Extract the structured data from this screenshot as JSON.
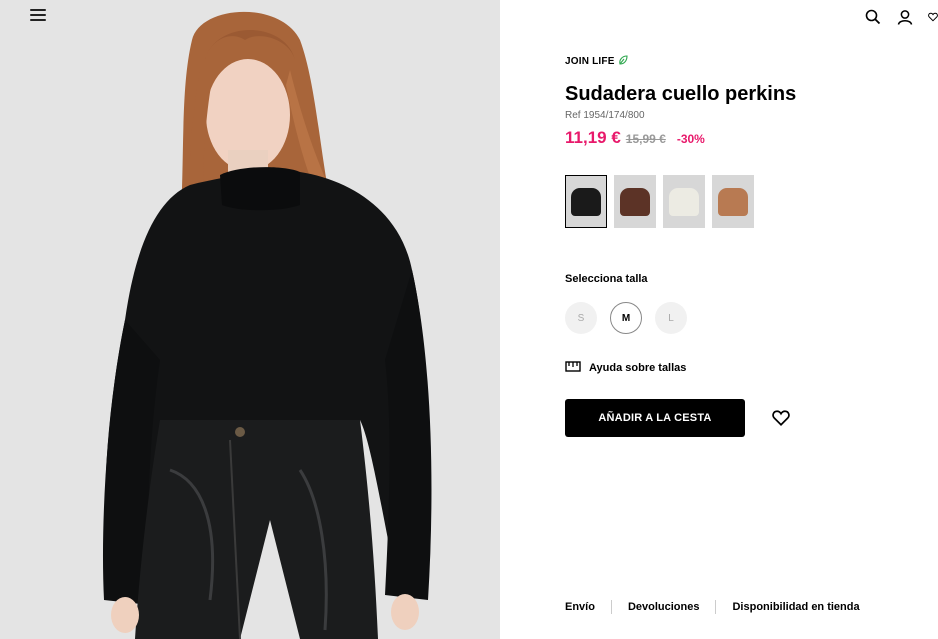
{
  "header": {
    "menu_icon": "hamburger-menu-icon",
    "icons": [
      "search-icon",
      "user-icon",
      "heart-icon"
    ]
  },
  "product": {
    "badge": "JOIN LIFE",
    "badge_icon": "leaf-icon",
    "title": "Sudadera cuello perkins",
    "ref": "Ref 1954/174/800",
    "price_now": "11,19 €",
    "price_old": "15,99 €",
    "discount": "-30%",
    "colors": [
      {
        "name": "negro",
        "hex": "#1a1a1a",
        "selected": true
      },
      {
        "name": "marrón",
        "hex": "#5c3326",
        "selected": false
      },
      {
        "name": "crudo",
        "hex": "#ecebe3",
        "selected": false
      },
      {
        "name": "camel",
        "hex": "#b87a52",
        "selected": false
      }
    ],
    "size_label": "Selecciona talla",
    "sizes": [
      {
        "label": "S",
        "available": false
      },
      {
        "label": "M",
        "available": true
      },
      {
        "label": "L",
        "available": false
      }
    ],
    "size_help": "Ayuda sobre tallas",
    "add_to_cart": "AÑADIR A LA CESTA"
  },
  "footer": {
    "links": [
      "Envío",
      "Devoluciones",
      "Disponibilidad en tienda"
    ]
  },
  "colors": {
    "accent": "#e8196b",
    "button_bg": "#000000",
    "badge_leaf": "#2fa84f"
  }
}
